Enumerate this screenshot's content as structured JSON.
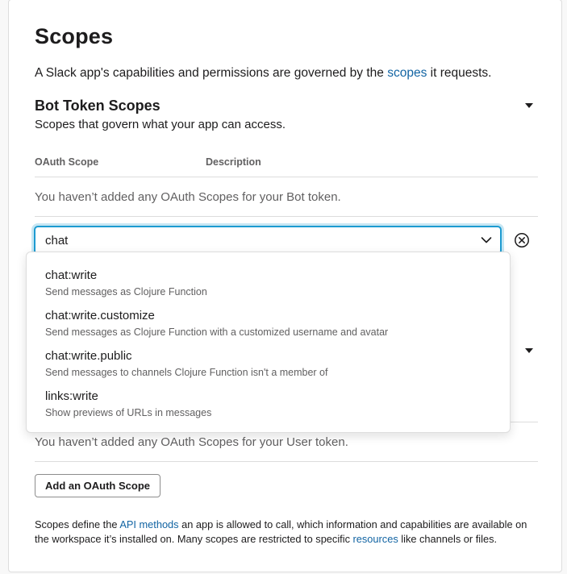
{
  "page": {
    "title": "Scopes",
    "intro_before": "A Slack app's capabilities and permissions are governed by the ",
    "intro_link": "scopes",
    "intro_after": " it requests."
  },
  "bot_section": {
    "title": "Bot Token Scopes",
    "subtitle": "Scopes that govern what your app can access.",
    "col_scope": "OAuth Scope",
    "col_description": "Description",
    "empty_text": "You haven’t added any OAuth Scopes for your Bot token."
  },
  "search": {
    "value": "chat"
  },
  "dropdown": {
    "options": [
      {
        "name": "chat:write",
        "description": "Send messages as Clojure Function"
      },
      {
        "name": "chat:write.customize",
        "description": "Send messages as Clojure Function with a customized username and avatar"
      },
      {
        "name": "chat:write.public",
        "description": "Send messages to channels Clojure Function isn't a member of"
      },
      {
        "name": "links:write",
        "description": "Show previews of URLs in messages"
      }
    ]
  },
  "user_section": {
    "empty_text": "You haven’t added any OAuth Scopes for your User token.",
    "add_button": "Add an OAuth Scope"
  },
  "footer": {
    "part1": "Scopes define the ",
    "link1": "API methods",
    "part2": " an app is allowed to call, which information and capabilities are available on the workspace it’s installed on. Many scopes are restricted to specific ",
    "link2": "resources",
    "part3": " like channels or files."
  },
  "colors": {
    "link": "#1264a3",
    "focus": "#1d9bd1"
  }
}
